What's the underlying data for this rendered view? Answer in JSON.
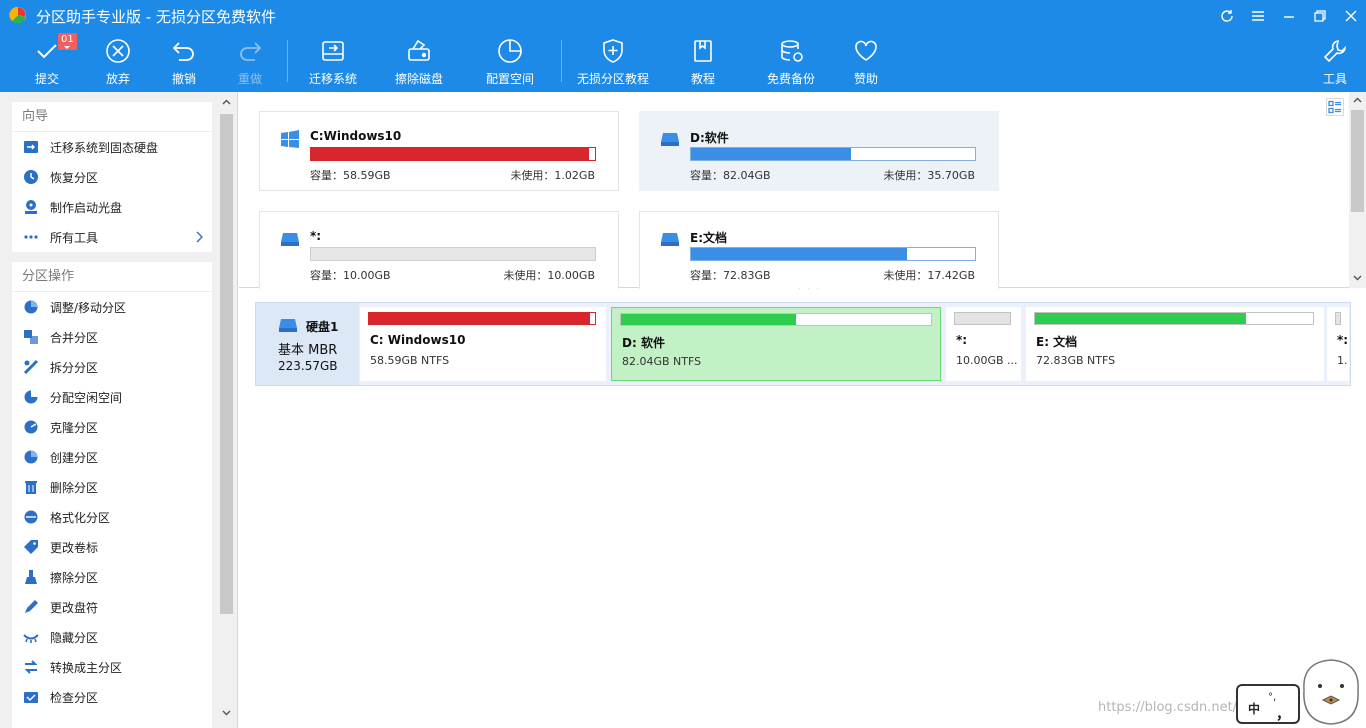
{
  "window": {
    "title": "分区助手专业版 - 无损分区免费软件",
    "controls": [
      "refresh-icon",
      "menu-icon",
      "minimize-icon",
      "restore-icon",
      "close-icon"
    ]
  },
  "toolbar": {
    "submit": "提交",
    "submit_badge": "01",
    "discard": "放弃",
    "undo": "撤销",
    "redo": "重做",
    "migrate": "迁移系统",
    "wipe_disk": "擦除磁盘",
    "allocate": "配置空间",
    "tutorial_lossless": "无损分区教程",
    "tutorial": "教程",
    "backup": "免费备份",
    "sponsor": "赞助",
    "tools": "工具"
  },
  "sidebar": {
    "wizard_title": "向导",
    "wizard_items": [
      {
        "label": "迁移系统到固态硬盘",
        "icon": "migrate-ssd-icon"
      },
      {
        "label": "恢复分区",
        "icon": "recover-partition-icon"
      },
      {
        "label": "制作启动光盘",
        "icon": "boot-disc-icon"
      },
      {
        "label": "所有工具",
        "icon": "all-tools-icon"
      }
    ],
    "ops_title": "分区操作",
    "ops_items": [
      {
        "label": "调整/移动分区",
        "icon": "resize-icon"
      },
      {
        "label": "合并分区",
        "icon": "merge-icon"
      },
      {
        "label": "拆分分区",
        "icon": "split-icon"
      },
      {
        "label": "分配空闲空间",
        "icon": "allocate-icon"
      },
      {
        "label": "克隆分区",
        "icon": "clone-icon"
      },
      {
        "label": "创建分区",
        "icon": "create-icon"
      },
      {
        "label": "删除分区",
        "icon": "delete-icon"
      },
      {
        "label": "格式化分区",
        "icon": "format-icon"
      },
      {
        "label": "更改卷标",
        "icon": "label-icon"
      },
      {
        "label": "擦除分区",
        "icon": "wipe-icon"
      },
      {
        "label": "更改盘符",
        "icon": "drive-letter-icon"
      },
      {
        "label": "隐藏分区",
        "icon": "hide-icon"
      },
      {
        "label": "转换成主分区",
        "icon": "convert-icon"
      },
      {
        "label": "检查分区",
        "icon": "check-icon"
      }
    ]
  },
  "cards": [
    {
      "name": "C:Windows10",
      "capacity": "容量：58.59GB",
      "unused": "未使用：1.02GB",
      "used_fraction": 0.98,
      "color": "#d9262c",
      "selected": false,
      "icon": "windows-icon"
    },
    {
      "name": "D:软件",
      "capacity": "容量：82.04GB",
      "unused": "未使用：35.70GB",
      "used_fraction": 0.565,
      "color": "#3b8ee6",
      "selected": true,
      "icon": "drive-icon"
    },
    {
      "name": "*:",
      "capacity": "容量：10.00GB",
      "unused": "未使用：10.00GB",
      "used_fraction": 0.0,
      "color": "#3b8ee6",
      "selected": false,
      "icon": "drive-icon"
    },
    {
      "name": "E:文档",
      "capacity": "容量：72.83GB",
      "unused": "未使用：17.42GB",
      "used_fraction": 0.76,
      "color": "#3b8ee6",
      "selected": false,
      "icon": "drive-icon"
    }
  ],
  "disk": {
    "name": "硬盘1",
    "type": "基本 MBR",
    "size": "223.57GB",
    "partitions": [
      {
        "name": "C: Windows10",
        "info": "58.59GB NTFS",
        "used_fraction": 0.98,
        "color": "#d9262c",
        "selected": false
      },
      {
        "name": "D: 软件",
        "info": "82.04GB NTFS",
        "used_fraction": 0.565,
        "color": "#2ecc4f",
        "selected": true
      },
      {
        "name": "*:",
        "info": "10.00GB ...",
        "used_fraction": 0.0,
        "color": "#2ecc4f",
        "selected": false
      },
      {
        "name": "E: 文档",
        "info": "72.83GB NTFS",
        "used_fraction": 0.76,
        "color": "#2ecc4f",
        "selected": false
      },
      {
        "name": "*:",
        "info": "1.",
        "used_fraction": 0.0,
        "color": "#2ecc4f",
        "selected": false
      }
    ]
  },
  "ime": {
    "lang": "中",
    "punct_a": "°,",
    "punct_b": "，"
  },
  "watermark": "https://blog.csdn.net/..."
}
